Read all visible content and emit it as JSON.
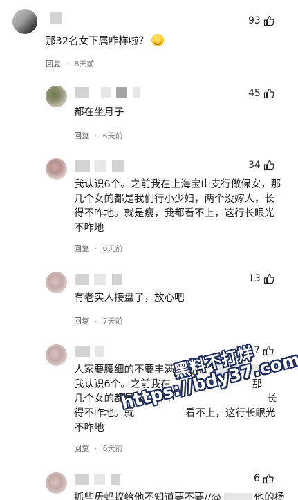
{
  "comments": [
    {
      "likes": "93",
      "text": "那32名女下属咋样啦？",
      "reply": "回复",
      "time": "8天前"
    },
    {
      "likes": "45",
      "text": "都在坐月子",
      "reply": "回复",
      "time": "6天前"
    },
    {
      "likes": "34",
      "text_lines": [
        "我认识6个。之前我在上海宝山支行做保安，那",
        "几个女的都是我们行小少妇，两个没嫁人，长",
        "得不咋地。就是瘦，我都看不上，这行长眼光",
        "不咋地"
      ],
      "reply": "回复",
      "time": "6天前"
    },
    {
      "likes": "13",
      "text": "有老实人接盘了，放心吧",
      "reply": "回复",
      "time": "7天前"
    },
    {
      "likes": "7",
      "text_lines": [
        "人家要腰细的不要丰满的",
        "我认识6个。之前我在",
        "几个女的都是我们行小",
        "得不咋地。就",
        "不咋地"
      ],
      "text_line1_suffix": "//",
      "text_line2_tail": "那",
      "text_line3_tail": "长",
      "text_line4_tail": "看不上，这行长眼光",
      "reply": "回复",
      "time": "6天前"
    },
    {
      "likes": "6",
      "text": "抓些毋蚂蚁给他不知道要不要//@",
      "text_tail": "他的杨"
    }
  ],
  "watermark": {
    "line1": "黑料不打烊",
    "line2": "https://bdy37.com"
  },
  "colors": {
    "meta": "#808080",
    "text": "#1e1e1e",
    "watermark_outline": "#1d2d5c"
  },
  "icons": [
    "thumbs-up-icon",
    "smile-emoji-icon",
    "laugh-emoji-icon"
  ]
}
